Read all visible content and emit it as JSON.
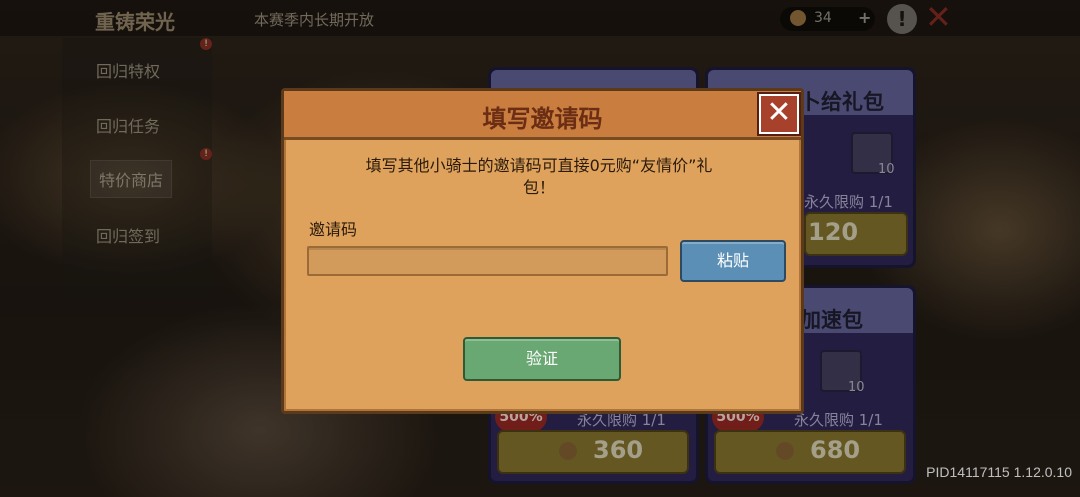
{
  "top": {
    "title": "重铸荣光",
    "subtitle": "本赛季内长期开放",
    "coins": "34",
    "plus": "+",
    "alert": "!"
  },
  "sidebar": {
    "items": [
      {
        "label": "回归特权"
      },
      {
        "label": "回归任务"
      },
      {
        "label": "特价商店"
      },
      {
        "label": "回归签到"
      }
    ],
    "badge": "!"
  },
  "cards": [
    {
      "title": "",
      "limit": "",
      "price": "",
      "badge": ""
    },
    {
      "title": "卜给礼包",
      "limit": "永久限购 1/1",
      "price": "120",
      "item_count": "10",
      "badge": ""
    },
    {
      "title": "",
      "limit": "永久限购 1/1",
      "price": "360",
      "badge": "500%"
    },
    {
      "title": "加速包",
      "limit": "永久限购 1/1",
      "price": "680",
      "item_count": "10",
      "badge": "500%"
    }
  ],
  "dialog": {
    "title": "填写邀请码",
    "close": "✕",
    "description": "填写其他小骑士的邀请码可直接0元购“友情价”礼包！",
    "invite_label": "邀请码",
    "invite_value": "",
    "paste_label": "粘贴",
    "verify_label": "验证"
  },
  "footer": {
    "pid": "PID14117115 1.12.0.10"
  },
  "colors": {
    "dialog_bg": "#dfa25c",
    "dialog_header": "#c97d3f",
    "title_text": "#6b2e14",
    "paste_button": "#5b8fb6",
    "verify_button": "#6aa873",
    "close_button": "#a8412c"
  }
}
